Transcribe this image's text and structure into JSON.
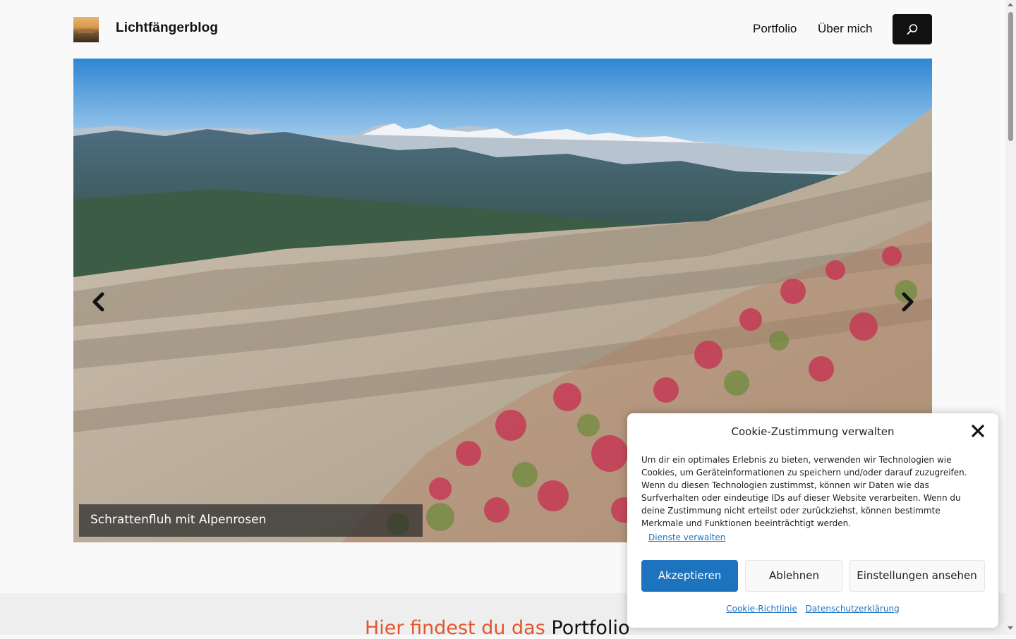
{
  "site": {
    "title": "Lichtfängerblog"
  },
  "nav": {
    "items": [
      "Portfolio",
      "Über mich"
    ]
  },
  "slider": {
    "caption": "Schrattenfluh mit Alpenrosen"
  },
  "portfolio": {
    "heading_highlight": "Hier findest du das",
    "heading_rest": "Portfolio"
  },
  "cookie": {
    "title": "Cookie-Zustimmung verwalten",
    "body": "Um dir ein optimales Erlebnis zu bieten, verwenden wir Technologien wie Cookies, um Geräteinformationen zu speichern und/oder darauf zuzugreifen. Wenn du diesen Technologien zustimmst, können wir Daten wie das Surfverhalten oder eindeutige IDs auf dieser Website verarbeiten. Wenn du deine Zustimmung nicht erteilst oder zurückziehst, können bestimmte Merkmale und Funktionen beeinträchtigt werden.",
    "manage_services": "Dienste verwalten",
    "accept": "Akzeptieren",
    "deny": "Ablehnen",
    "view_settings": "Einstellungen ansehen",
    "cookie_policy": "Cookie-Richtlinie",
    "privacy_policy": "Datenschutzerklärung"
  },
  "colors": {
    "accent": "#1e73be",
    "heading_highlight": "#e4552d",
    "search_button": "#111111"
  },
  "icons": {
    "search": "search-icon",
    "prev": "chevron-left-icon",
    "next": "chevron-right-icon",
    "close": "close-icon"
  }
}
